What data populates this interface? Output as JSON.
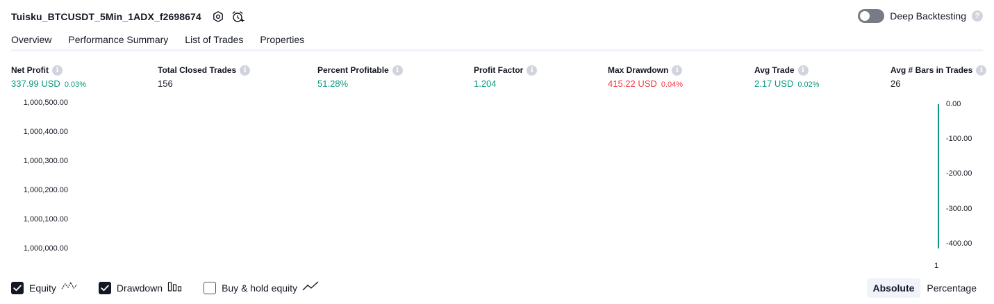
{
  "header": {
    "strategy_name": "Tuisku_BTCUSDT_5Min_1ADX_f2698674",
    "settings_icon": "gear-icon",
    "alert_icon": "alarm-clock-plus-icon"
  },
  "deep_backtesting": {
    "label": "Deep Backtesting",
    "enabled": false
  },
  "tabs": [
    {
      "label": "Overview",
      "active": true
    },
    {
      "label": "Performance Summary",
      "active": false
    },
    {
      "label": "List of Trades",
      "active": false
    },
    {
      "label": "Properties",
      "active": false
    }
  ],
  "metrics": [
    {
      "label": "Net Profit",
      "value": "337.99 USD",
      "sub": "0.03%",
      "tone": "green"
    },
    {
      "label": "Total Closed Trades",
      "value": "156",
      "sub": "",
      "tone": "dark"
    },
    {
      "label": "Percent Profitable",
      "value": "51.28%",
      "sub": "",
      "tone": "green"
    },
    {
      "label": "Profit Factor",
      "value": "1.204",
      "sub": "",
      "tone": "green"
    },
    {
      "label": "Max Drawdown",
      "value": "415.22 USD",
      "sub": "0.04%",
      "tone": "red"
    },
    {
      "label": "Avg Trade",
      "value": "2.17 USD",
      "sub": "0.02%",
      "tone": "green"
    },
    {
      "label": "Avg # Bars in Trades",
      "value": "26",
      "sub": "",
      "tone": "dark"
    }
  ],
  "chart": {
    "left_axis": [
      "1,000,500.00",
      "1,000,400.00",
      "1,000,300.00",
      "1,000,200.00",
      "1,000,100.00",
      "1,000,000.00"
    ],
    "right_axis": [
      "0.00",
      "-100.00",
      "-200.00",
      "-300.00",
      "-400.00"
    ],
    "x_tick": "1",
    "colors": {
      "equity": "#089981",
      "drawdown": "#089981"
    }
  },
  "legend": {
    "equity": {
      "label": "Equity",
      "checked": true,
      "icon": "equity-line-icon"
    },
    "drawdown": {
      "label": "Drawdown",
      "checked": true,
      "icon": "drawdown-bars-icon"
    },
    "buy_hold": {
      "label": "Buy & hold equity",
      "checked": false,
      "icon": "buy-hold-line-icon"
    }
  },
  "view_mode": {
    "options": [
      "Absolute",
      "Percentage"
    ],
    "selected": "Absolute"
  }
}
